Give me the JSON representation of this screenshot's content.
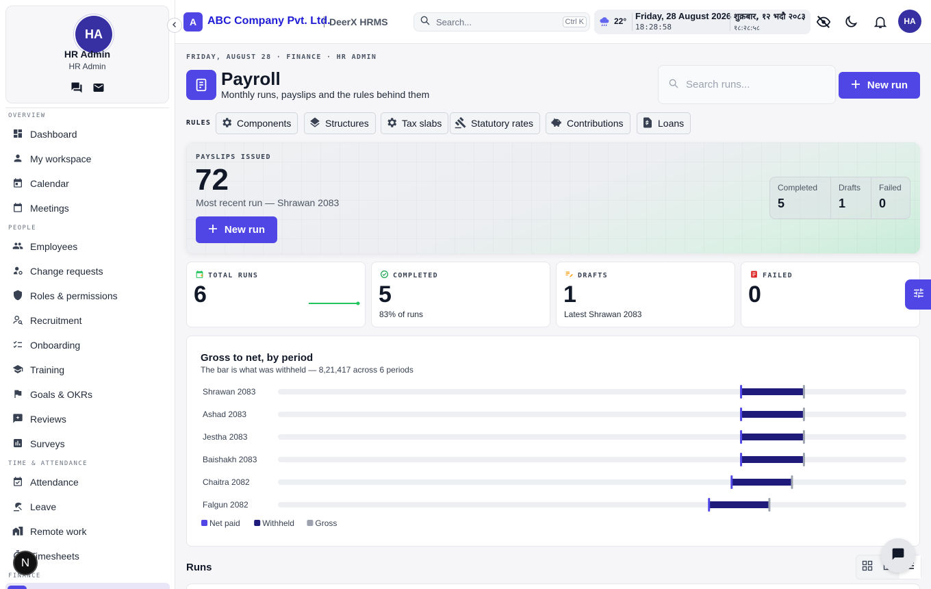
{
  "profile": {
    "initials": "HA",
    "name": "HR Admin",
    "role": "HR Admin"
  },
  "sidebar": {
    "sections": [
      {
        "label": "OVERVIEW"
      },
      {
        "label": "PEOPLE"
      },
      {
        "label": "TIME & ATTENDANCE"
      },
      {
        "label": "FINANCE"
      }
    ],
    "items": [
      {
        "label": "Dashboard",
        "icon": "dashboard-icon"
      },
      {
        "label": "My workspace",
        "icon": "person-icon"
      },
      {
        "label": "Calendar",
        "icon": "calendar-icon"
      },
      {
        "label": "Meetings",
        "icon": "meetings-icon"
      },
      {
        "label": "Employees",
        "icon": "people-icon"
      },
      {
        "label": "Change requests",
        "icon": "person-gear-icon"
      },
      {
        "label": "Roles & permissions",
        "icon": "shield-icon"
      },
      {
        "label": "Recruitment",
        "icon": "person-search-icon"
      },
      {
        "label": "Onboarding",
        "icon": "checklist-icon"
      },
      {
        "label": "Training",
        "icon": "school-icon"
      },
      {
        "label": "Goals & OKRs",
        "icon": "flag-icon"
      },
      {
        "label": "Reviews",
        "icon": "rate-review-icon"
      },
      {
        "label": "Surveys",
        "icon": "poll-icon"
      },
      {
        "label": "Attendance",
        "icon": "event-check-icon"
      },
      {
        "label": "Leave",
        "icon": "beach-icon"
      },
      {
        "label": "Remote work",
        "icon": "home-work-icon"
      },
      {
        "label": "Timesheets",
        "icon": "timer-icon"
      }
    ],
    "badge": "N"
  },
  "topbar": {
    "logo_letter": "A",
    "company": "ABC Company Pvt. Ltd.",
    "app": "DeerX HRMS",
    "search_placeholder": "Search...",
    "shortcut": "Ctrl K",
    "temperature": "22°",
    "date": "Friday, 28 August 2026",
    "time": "18:28:58",
    "nepali_date": "शुक्रबार, १२ भदौ २०८३",
    "nepali_time": "१८:२८:५८",
    "avatar": "HA"
  },
  "page": {
    "breadcrumb": "FRIDAY, AUGUST 28 · FINANCE · HR ADMIN",
    "title": "Payroll",
    "subtitle": "Monthly runs, payslips and the rules behind them",
    "search_placeholder": "Search runs...",
    "new_run_label": "New run",
    "rules_label": "RULES",
    "rules": [
      {
        "label": "Components",
        "icon": "gear-icon"
      },
      {
        "label": "Structures",
        "icon": "layers-icon"
      },
      {
        "label": "Tax slabs",
        "icon": "gear-icon"
      },
      {
        "label": "Statutory rates",
        "icon": "gavel-icon"
      },
      {
        "label": "Contributions",
        "icon": "piggy-bank-icon"
      },
      {
        "label": "Loans",
        "icon": "document-money-icon"
      }
    ]
  },
  "hero": {
    "label": "PAYSLIPS ISSUED",
    "value": "72",
    "subtitle": "Most recent run — Shrawan 2083",
    "button": "New run",
    "stats": [
      {
        "label": "Completed",
        "value": "5"
      },
      {
        "label": "Drafts",
        "value": "1"
      },
      {
        "label": "Failed",
        "value": "0"
      }
    ]
  },
  "cards": [
    {
      "label": "TOTAL RUNS",
      "value": "6",
      "sub": "",
      "icon": "calendar-plus-icon",
      "icon_color": "#22c55e"
    },
    {
      "label": "COMPLETED",
      "value": "5",
      "sub": "83% of runs",
      "icon": "check-circle-icon",
      "icon_color": "#16a34a"
    },
    {
      "label": "DRAFTS",
      "value": "1",
      "sub": "Latest Shrawan 2083",
      "icon": "edit-note-icon",
      "icon_color": "#f59e0b"
    },
    {
      "label": "FAILED",
      "value": "0",
      "sub": "",
      "icon": "report-icon",
      "icon_color": "#dc2626"
    }
  ],
  "chart_data": {
    "type": "bar",
    "title": "Gross to net, by period",
    "subtitle": "The bar is what was withheld — 8,21,417 across 6 periods",
    "categories": [
      "Shrawan 2083",
      "Ashad 2083",
      "Jestha 2083",
      "Baishakh 2083",
      "Chaitra 2082",
      "Falgun 2082"
    ],
    "series": [
      {
        "name": "Net paid",
        "values": [
          0.737,
          0.737,
          0.737,
          0.737,
          0.722,
          0.686
        ],
        "color": "#4f46e5"
      },
      {
        "name": "Withheld",
        "values": [
          0.1,
          0.1,
          0.1,
          0.1,
          0.096,
          0.096
        ],
        "color": "#1e1b7b"
      },
      {
        "name": "Gross",
        "values": [
          0.837,
          0.837,
          0.837,
          0.837,
          0.818,
          0.782
        ],
        "color": "#9ca3af"
      }
    ],
    "legend": "bottom-left"
  },
  "runs": {
    "title": "Runs"
  }
}
